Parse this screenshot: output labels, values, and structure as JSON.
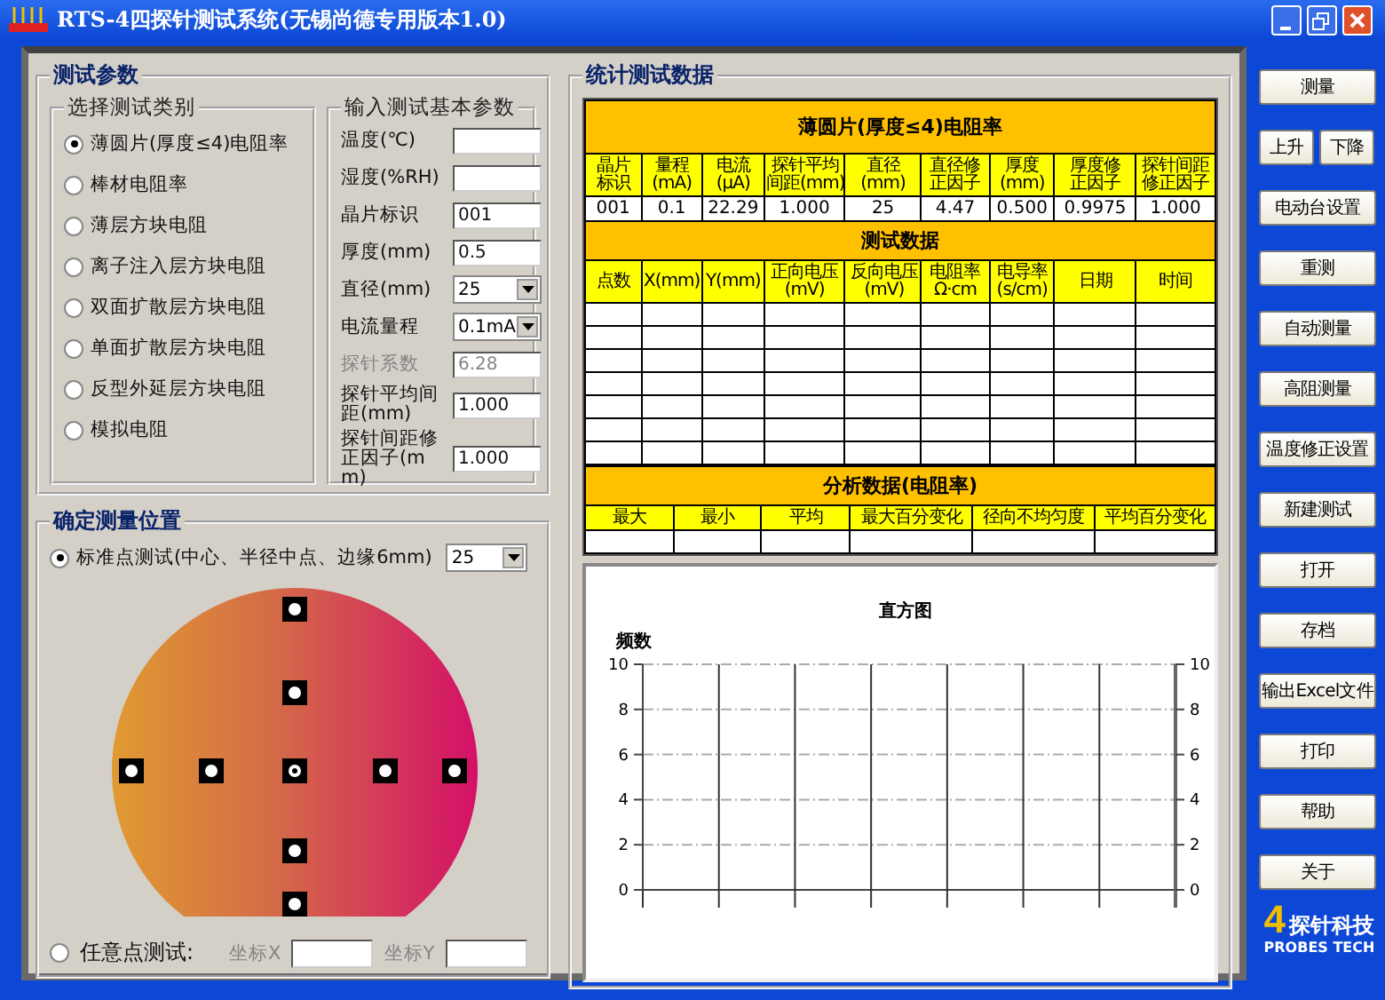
{
  "window": {
    "title": "RTS-4四探针测试系统(无锡尚德专用版本1.0)"
  },
  "test_params": {
    "title": "测试参数",
    "category": {
      "title": "选择测试类别",
      "options": [
        {
          "label": "薄圆片(厚度≤4)电阻率",
          "selected": true
        },
        {
          "label": "棒材电阻率",
          "selected": false
        },
        {
          "label": "薄层方块电阻",
          "selected": false
        },
        {
          "label": "离子注入层方块电阻",
          "selected": false
        },
        {
          "label": "双面扩散层方块电阻",
          "selected": false
        },
        {
          "label": "单面扩散层方块电阻",
          "selected": false
        },
        {
          "label": "反型外延层方块电阻",
          "selected": false
        },
        {
          "label": "模拟电阻",
          "selected": false
        }
      ]
    },
    "basic": {
      "title": "输入测试基本参数",
      "fields": [
        {
          "label": "温度(℃)",
          "kind": "text",
          "disabled": false
        },
        {
          "label": "湿度(%RH)",
          "kind": "text",
          "disabled": false
        },
        {
          "label": "晶片标识",
          "kind": "text",
          "value": "001",
          "disabled": false
        },
        {
          "label": "厚度(mm)",
          "kind": "text",
          "value": "0.5",
          "disabled": false
        },
        {
          "label": "直径(mm)",
          "kind": "select",
          "value": "25",
          "disabled": false
        },
        {
          "label": "电流量程",
          "kind": "select",
          "value": "0.1mA",
          "disabled": false
        },
        {
          "label": "探针系数",
          "kind": "text",
          "value": "6.28",
          "disabled": true
        },
        {
          "label": "探针平均间距(mm)",
          "kind": "text",
          "value": "1.000",
          "disabled": false
        },
        {
          "label": "探针间距修正因子(mm)",
          "kind": "text",
          "value": "1.000",
          "disabled": false
        }
      ]
    }
  },
  "position": {
    "title": "确定测量位置",
    "standard": {
      "label": "标准点测试(中心、半径中点、边缘6mm)",
      "selected": true,
      "select_value": "25"
    },
    "arbitrary": {
      "label": "任意点测试:",
      "selected": false,
      "coords": [
        {
          "label": "坐标X",
          "disabled": true
        },
        {
          "label": "坐标Y",
          "disabled": true
        }
      ]
    }
  },
  "stats": {
    "title": "统计测试数据",
    "wafer_table": {
      "title": "薄圆片(厚度≤4)电阻率",
      "columns": [
        "晶片标识",
        "量程\n(mA)",
        "电流\n(μA)",
        "探针平均间距(mm)",
        "直径\n(mm)",
        "直径修正因子",
        "厚度\n(mm)",
        "厚度修正因子",
        "探针间距修正因子"
      ],
      "row": [
        "001",
        "0.1",
        "22.29",
        "1.000",
        "25",
        "4.47",
        "0.500",
        "0.9975",
        "1.000"
      ]
    },
    "test_table": {
      "title": "测试数据",
      "columns": [
        "点数",
        "X(mm)",
        "Y(mm)",
        "正向电压(mV)",
        "反向电压(mV)",
        "电阻率\nΩ·cm",
        "电导率\n(s/cm)",
        "日期",
        "时间"
      ]
    },
    "analysis_table": {
      "title": "分析数据(电阻率)",
      "columns": [
        "最大",
        "最小",
        "平均",
        "最大百分变化",
        "径向不均匀度",
        "平均百分变化"
      ]
    },
    "histogram": {
      "chart_data": {
        "type": "bar",
        "title": "直方图",
        "ylabel": "频数",
        "categories": [
          null,
          null,
          null,
          null,
          null,
          null,
          null
        ],
        "values": [
          null,
          null,
          null,
          null,
          null,
          null,
          null
        ],
        "ylim": [
          0,
          10
        ],
        "yticks": [
          0,
          2,
          4,
          6,
          8,
          10
        ],
        "grid": true
      },
      "right_axis_ticks": [
        "10",
        "8",
        "6",
        "4",
        "2",
        "0"
      ]
    }
  },
  "side_buttons": [
    [
      "测量"
    ],
    [
      "上升",
      "下降"
    ],
    [
      "电动台设置"
    ],
    [
      "重测"
    ],
    [
      "自动测量"
    ],
    [
      "高阻测量"
    ],
    [
      "温度修正设置"
    ],
    [
      "新建测试"
    ],
    [
      "打开"
    ],
    [
      "存档"
    ],
    [
      "输出Excel文件"
    ],
    [
      "打印"
    ],
    [
      "帮助"
    ],
    [
      "关于"
    ]
  ],
  "logo": {
    "mark": "4",
    "name": "探针科技",
    "english": "PROBES TECH"
  }
}
